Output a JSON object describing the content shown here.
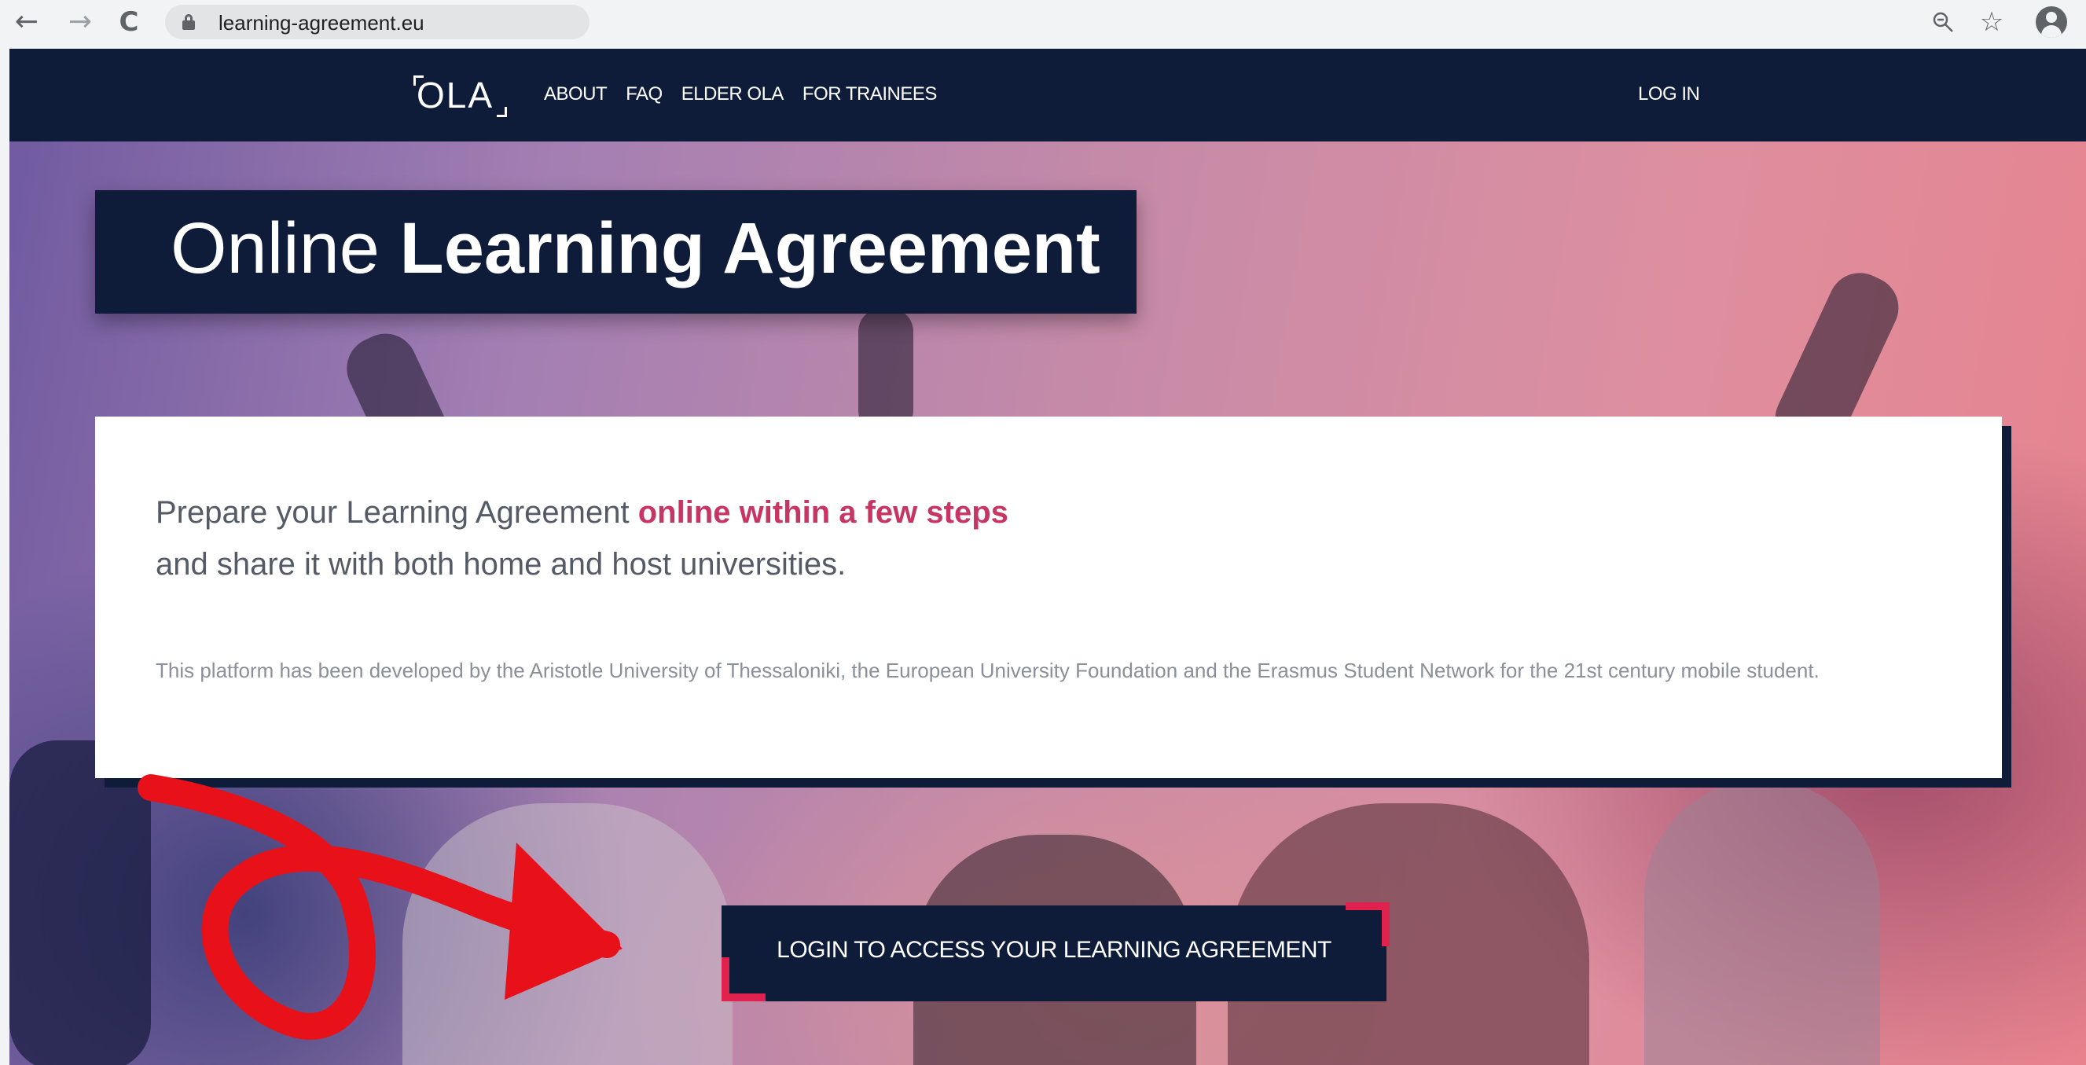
{
  "browser": {
    "url": "learning-agreement.eu",
    "icons": [
      "back-arrow-icon",
      "forward-arrow-icon",
      "reload-icon",
      "lock-icon",
      "zoom-icon",
      "star-icon",
      "profile-icon"
    ]
  },
  "header": {
    "logo": "OLA",
    "nav": [
      "ABOUT",
      "FAQ",
      "ELDER OLA",
      "FOR TRAINEES"
    ],
    "login": "LOG IN"
  },
  "hero": {
    "title_light": "Online",
    "title_bold": "Learning Agreement"
  },
  "card": {
    "line1_start": "Prepare your Learning Agreement ",
    "line1_highlight": "online within a few steps",
    "line2": "and share it with both home and host universities.",
    "description": "This platform has been developed by the Aristotle University of Thessaloniki, the European University Foundation and the Erasmus Student Network for the 21st century mobile student."
  },
  "cta": {
    "label": "LOGIN TO ACCESS YOUR LEARNING AGREEMENT"
  },
  "colors": {
    "navy": "#0e1c3a",
    "highlight": "#c73563",
    "cta_corner": "#e0234e",
    "annotation": "#e8111a"
  }
}
